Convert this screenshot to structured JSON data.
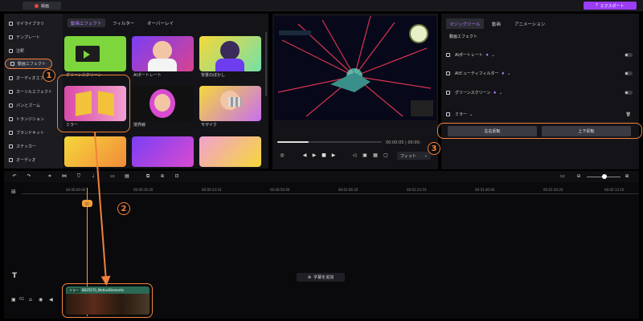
{
  "topbar": {
    "record_label": "録画",
    "export_label": "エクスポート"
  },
  "sidebar": {
    "items": [
      {
        "label": "マイライブラリ"
      },
      {
        "label": "テンプレート"
      },
      {
        "label": "注釈"
      },
      {
        "label": "動画エフェクト"
      },
      {
        "label": "オーディオエフ"
      },
      {
        "label": "カーソルエフェクト"
      },
      {
        "label": "パンとズーム"
      },
      {
        "label": "トランジション"
      },
      {
        "label": "ブランドキット"
      },
      {
        "label": "ステッカー"
      },
      {
        "label": "オーディオ"
      }
    ]
  },
  "effects": {
    "tabs": [
      {
        "label": "動画エフェクト"
      },
      {
        "label": "フィルター"
      },
      {
        "label": "オーバーレイ"
      }
    ],
    "thumbs": [
      {
        "label": "グリーンスクリーン"
      },
      {
        "label": "AIポートレート"
      },
      {
        "label": "背景のぼかし"
      },
      {
        "label": "ミラー"
      },
      {
        "label": "境界線"
      },
      {
        "label": "モザイク"
      }
    ]
  },
  "preview": {
    "time": "00:00:05 | 00:00:",
    "fit": "フィット"
  },
  "right": {
    "tabs": [
      {
        "label": "マジックツール"
      },
      {
        "label": "動画"
      },
      {
        "label": "アニメーション"
      }
    ],
    "section_title": "動画エフェクト",
    "rows": [
      {
        "label": "AIポートレート"
      },
      {
        "label": "AIビューティフィルター"
      },
      {
        "label": "グリーンスクリーン"
      }
    ],
    "mirror_label": "ミラー",
    "flip_h": "左右反転",
    "flip_v": "上下反転"
  },
  "timeline": {
    "ticks": [
      "00:00:00:00",
      "00:00:16:20",
      "00:00:33:10",
      "00:00:50:00",
      "00:01:06:20",
      "00:01:23:10",
      "00:01:40:00",
      "00:01:56:20",
      "00:02:13:10"
    ],
    "add_subtitle": "字幕を追加",
    "clip_tag": "ミラー",
    "clip_name": "8625570_MotionElements",
    "track_number": "01"
  },
  "callouts": [
    "1",
    "2",
    "3"
  ],
  "colors": {
    "accent": "#9a3df5",
    "highlight": "#f2813a",
    "playhead": "#f2a13a"
  }
}
